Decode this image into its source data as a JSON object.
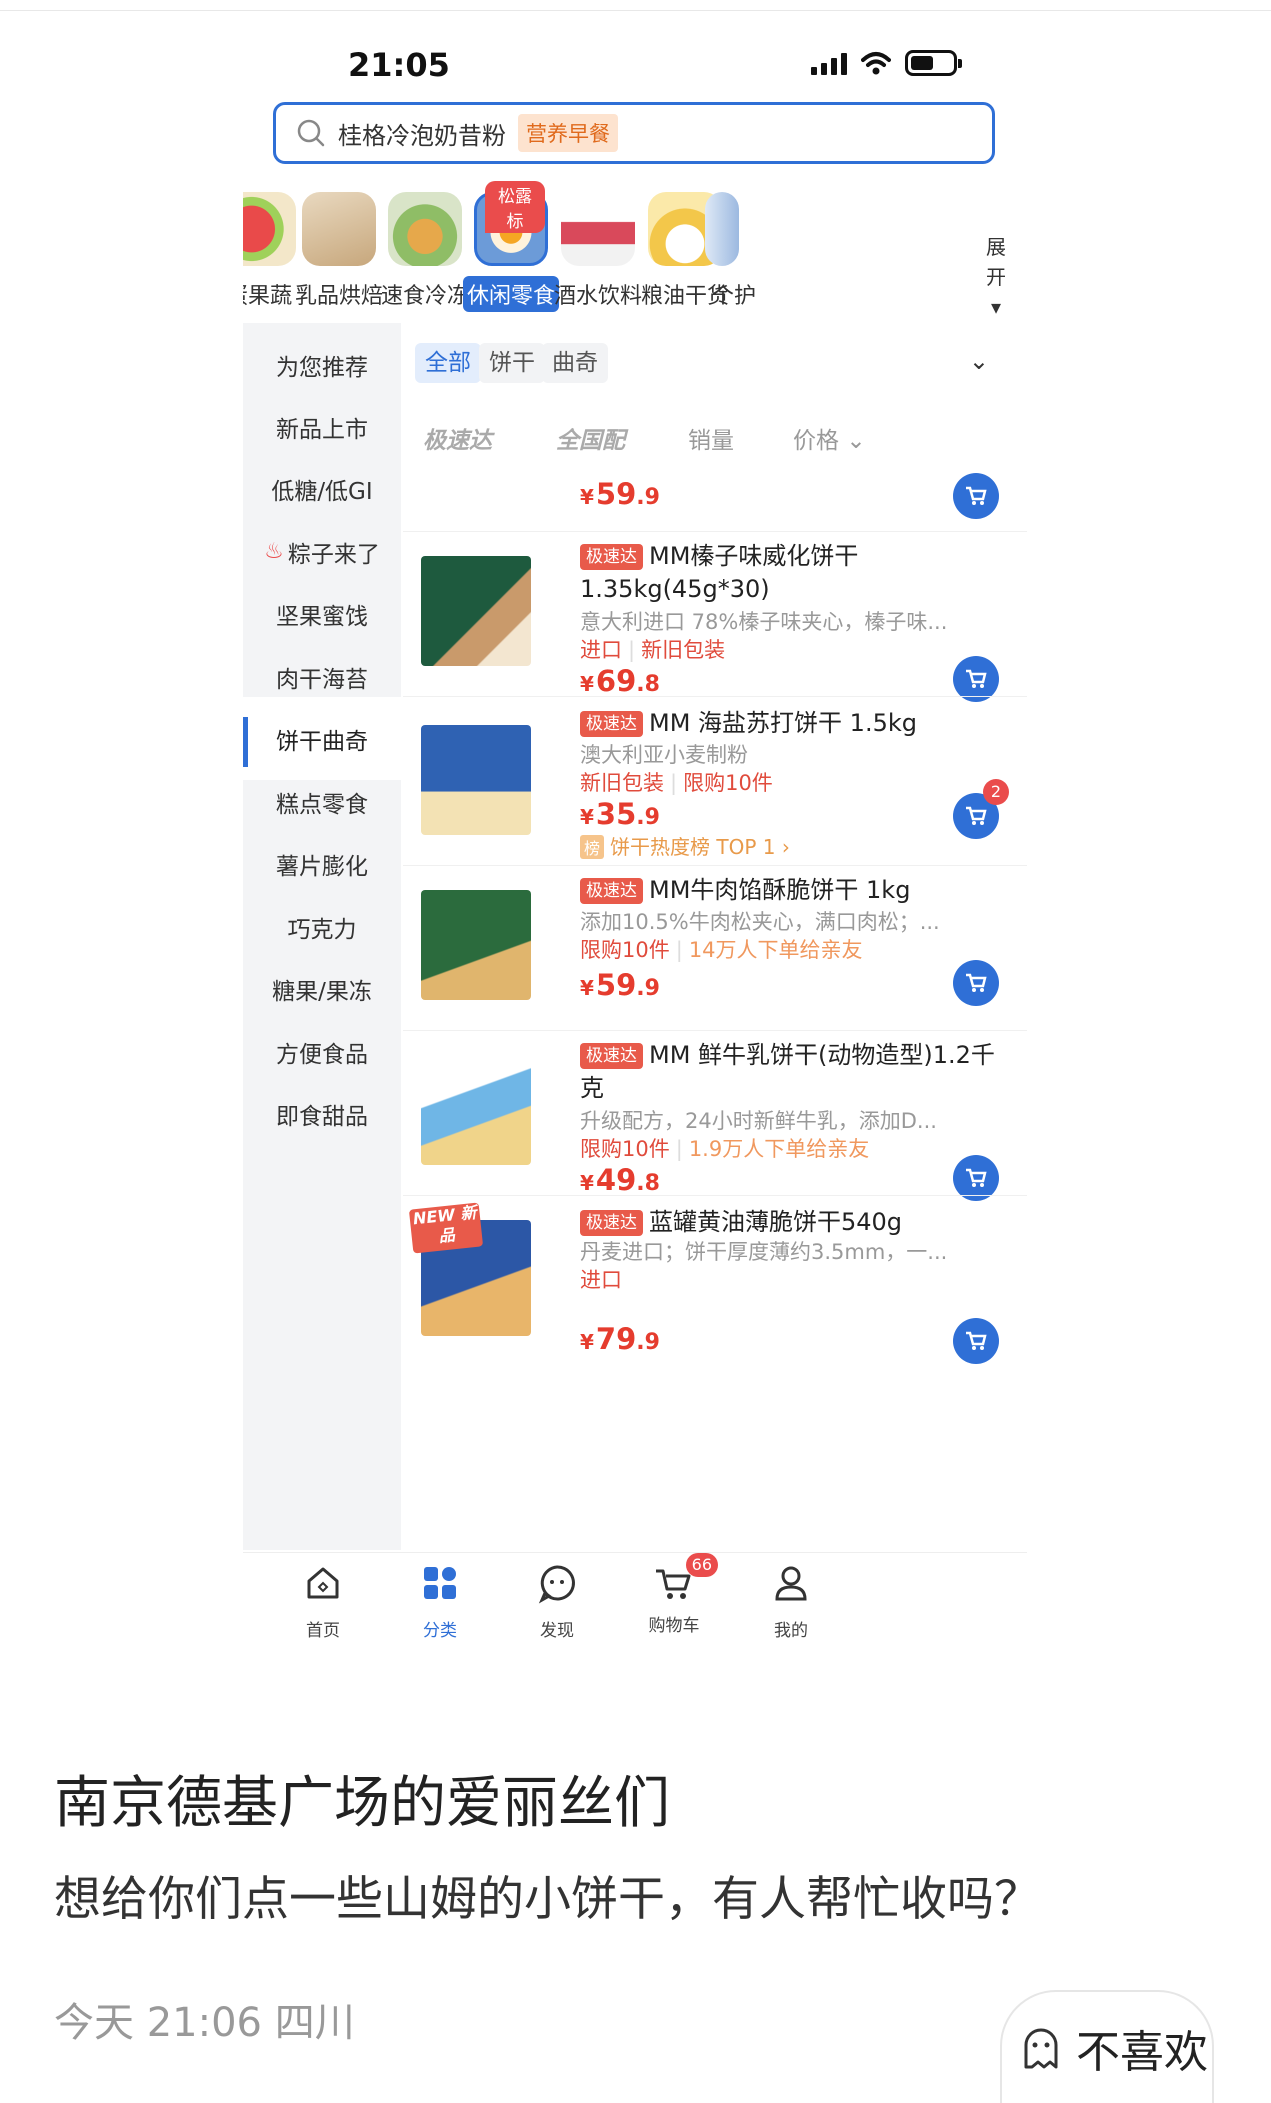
{
  "status_bar": {
    "time": "21:05"
  },
  "search": {
    "query": "桂格冷泡奶昔粉",
    "chip": "营养早餐"
  },
  "categories": [
    {
      "label": "蛋果蔬",
      "active": false
    },
    {
      "label": "乳品烘焙",
      "active": false
    },
    {
      "label": "速食冷冻",
      "active": false
    },
    {
      "label": "休闲零食",
      "active": true,
      "badge": "松露标"
    },
    {
      "label": "酒水饮料",
      "active": false
    },
    {
      "label": "粮油干货",
      "active": false
    },
    {
      "label": "个护",
      "active": false
    }
  ],
  "expand_label": "展开",
  "left_nav": [
    {
      "label": "为您推荐"
    },
    {
      "label": "新品上市"
    },
    {
      "label": "低糖/低GI"
    },
    {
      "label": "粽子来了",
      "fire": true
    },
    {
      "label": "坚果蜜饯"
    },
    {
      "label": "肉干海苔"
    },
    {
      "label": "饼干曲奇",
      "active": true
    },
    {
      "label": "糕点零食"
    },
    {
      "label": "薯片膨化"
    },
    {
      "label": "巧克力"
    },
    {
      "label": "糖果/果冻"
    },
    {
      "label": "方便食品"
    },
    {
      "label": "即食甜品"
    }
  ],
  "sub_tabs": [
    "全部",
    "饼干",
    "曲奇"
  ],
  "sort_options": {
    "fast": "极速达",
    "national": "全国配",
    "sales": "销量",
    "price": "价格"
  },
  "products": [
    {
      "price_int": "59",
      "price_dec": ".9"
    },
    {
      "fast_tag": "极速达",
      "title": "MM榛子味威化饼干1.35kg(45g*30)",
      "desc": "意大利进口 78%榛子味夹心，榛子味...",
      "tags": [
        "进口",
        "新旧包装"
      ],
      "price_int": "69",
      "price_dec": ".8"
    },
    {
      "fast_tag": "极速达",
      "title": "MM 海盐苏打饼干 1.5kg",
      "desc": "澳大利亚小麦制粉",
      "tags": [
        "新旧包装",
        "限购10件"
      ],
      "price_int": "35",
      "price_dec": ".9",
      "cart_badge": "2",
      "rank_icon": "榜",
      "rank": "饼干热度榜 TOP 1 ›"
    },
    {
      "fast_tag": "极速达",
      "title": "MM牛肉馅酥脆饼干 1kg",
      "desc": "添加10.5%牛肉松夹心，满口肉松；...",
      "tags": [
        "限购10件"
      ],
      "soft_tag": "14万人下单给亲友",
      "price_int": "59",
      "price_dec": ".9"
    },
    {
      "fast_tag": "极速达",
      "title": "MM 鲜牛乳饼干(动物造型)1.2千克",
      "desc": "升级配方，24小时新鲜牛乳，添加D...",
      "tags": [
        "限购10件"
      ],
      "soft_tag": "1.9万人下单给亲友",
      "price_int": "49",
      "price_dec": ".8"
    },
    {
      "fast_tag": "极速达",
      "title": "蓝罐黄油薄脆饼干540g",
      "desc": "丹麦进口；饼干厚度薄约3.5mm，一...",
      "tags": [
        "进口"
      ],
      "new_badge": "NEW 新品",
      "price_int": "79",
      "price_dec": ".9"
    }
  ],
  "tab_bar": [
    {
      "label": "首页",
      "icon": "home-icon"
    },
    {
      "label": "分类",
      "icon": "category-icon",
      "active": true
    },
    {
      "label": "发现",
      "icon": "discover-icon"
    },
    {
      "label": "购物车",
      "icon": "cart-icon",
      "badge": "66"
    },
    {
      "label": "我的",
      "icon": "profile-icon"
    }
  ],
  "post": {
    "title": "南京德基广场的爱丽丝们",
    "body": "想给你们点一些山姆的小饼干，有人帮忙收吗？",
    "meta": "今天 21:06 四川",
    "dislike": "不喜欢"
  },
  "colors": {
    "accent": "#2f6fd6",
    "price": "#e53c2e",
    "badge": "#ea4c4c"
  }
}
